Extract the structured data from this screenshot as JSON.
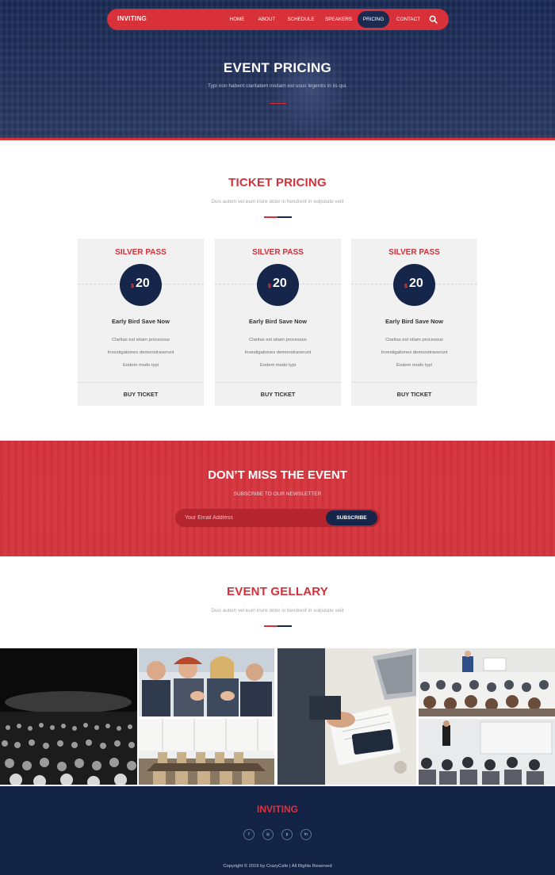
{
  "nav": {
    "brand": "INVITING",
    "items": [
      {
        "label": "HOME",
        "active": false
      },
      {
        "label": "ABOUT",
        "active": false
      },
      {
        "label": "SCHEDULE",
        "active": false
      },
      {
        "label": "SPEAKERS",
        "active": false
      },
      {
        "label": "PRICING",
        "active": true
      },
      {
        "label": "CONTACT",
        "active": false
      }
    ],
    "search_icon": "search-icon"
  },
  "hero": {
    "title": "EVENT PRICING",
    "subtitle": "Typi non habent claritatem insitam est usus legentis in iis qui."
  },
  "pricing": {
    "title": "TICKET PRICING",
    "subtitle": "Duis autem vel eum iriure dolor in hendrerit in vulputate velit",
    "cards": [
      {
        "name": "SILVER PASS",
        "currency": "$",
        "price": "20",
        "plan": "Early Bird Save Now",
        "features": [
          "Claritas est etiam processus",
          "Investigationes demonstraverunt",
          "Eodem modo typi"
        ],
        "button": "BUY TICKET"
      },
      {
        "name": "SILVER PASS",
        "currency": "$",
        "price": "20",
        "plan": "Early Bird Save Now",
        "features": [
          "Claritas est etiam processus",
          "Investigationes demonstraverunt",
          "Eodem modo typi"
        ],
        "button": "BUY TICKET"
      },
      {
        "name": "SILVER PASS",
        "currency": "$",
        "price": "20",
        "plan": "Early Bird Save Now",
        "features": [
          "Claritas est etiam processus",
          "Investigationes demonstraverunt",
          "Eodem modo typi"
        ],
        "button": "BUY TICKET"
      }
    ]
  },
  "newsletter": {
    "title": "DON’T MISS THE EVENT",
    "subtitle": "SUBSCRIBE TO OUR NEWSLETTER",
    "placeholder": "Your Email Address",
    "button": "SUBSCRIBE"
  },
  "gallery": {
    "title": "EVENT GELLARY",
    "subtitle": "Duis autem vel eum iriure dolor in hendrerit in vulputate velit"
  },
  "footer": {
    "brand": "INVITING",
    "social": [
      "facebook-icon",
      "dribbble-icon",
      "pinterest-icon",
      "linkedin-icon"
    ],
    "copyright": "Copyright © 2016 by CrazyCafe | All Rights Reserved"
  },
  "colors": {
    "accent_red": "#d5303a",
    "navy": "#15264a"
  }
}
